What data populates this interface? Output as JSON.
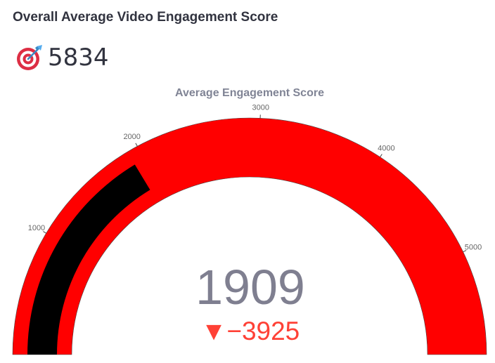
{
  "section_title": "Overall Average Video Engagement Score",
  "metric": {
    "icon": "target-icon",
    "value": "5834"
  },
  "chart_data": {
    "type": "gauge",
    "title": "Average Engagement Score",
    "value": 1909,
    "value_label": "1909",
    "delta": -3925,
    "delta_label": "▼−3925",
    "reference": 5834,
    "range": [
      0,
      5834
    ],
    "ticks": [
      1000,
      2000,
      3000,
      4000,
      5000
    ],
    "tick_labels": [
      "1000",
      "2000",
      "3000",
      "4000",
      "5000"
    ],
    "colors": {
      "track": "#ff0000",
      "bar": "#000000",
      "value_text": "#7f7f90",
      "delta_text": "#ff4136",
      "title_text": "#808495"
    }
  }
}
